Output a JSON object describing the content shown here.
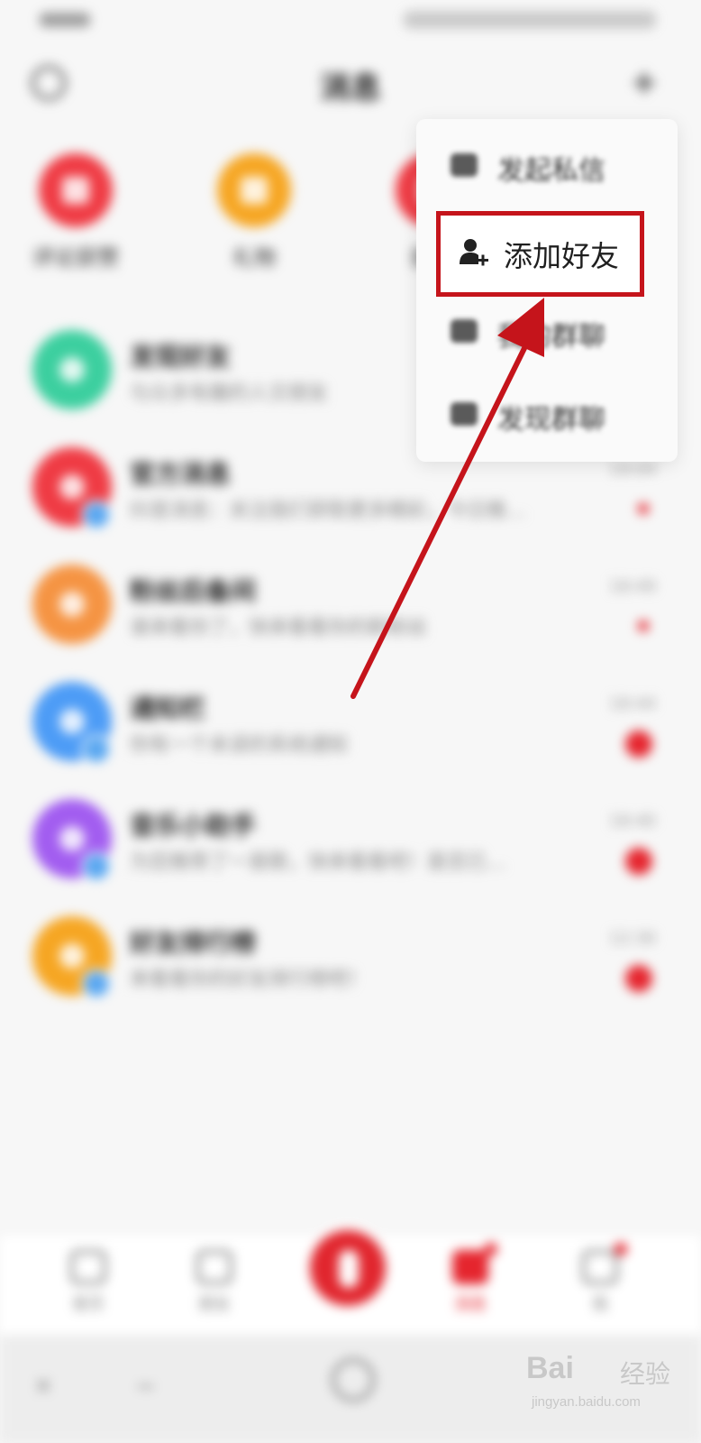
{
  "top_nav": {
    "title": "消息"
  },
  "shortcuts": [
    {
      "label": "评论获赞",
      "color": "#ef3b44"
    },
    {
      "label": "礼物",
      "color": "#f6a623"
    },
    {
      "label": "提醒",
      "color": "#ef3b44"
    }
  ],
  "menu": {
    "items": [
      {
        "label": "发起私信",
        "icon": "chat-icon"
      },
      {
        "label": "添加好友",
        "icon": "add-user-icon"
      },
      {
        "label": "我的群聊",
        "icon": "group-icon"
      },
      {
        "label": "发现群聊",
        "icon": "discover-group-icon"
      }
    ]
  },
  "chats": [
    {
      "name": "发现好友",
      "preview": "与众多有趣的人交朋友",
      "time": "",
      "color": "#3ccf9f",
      "badge": "none",
      "corner": false
    },
    {
      "name": "官方消息",
      "preview": "抖音消息：关注我们获取更多精彩，今日推…",
      "time": "19:04",
      "color": "#ef3b44",
      "badge": "dot",
      "corner": true
    },
    {
      "name": "粉丝后备间",
      "preview": "谁来看你了，快来看看你的新粉丝",
      "time": "18:49",
      "color": "#f59443",
      "badge": "dot",
      "corner": false
    },
    {
      "name": "通知栏",
      "preview": "你有一个未读的系统通知",
      "time": "18:44",
      "color": "#4d9cf6",
      "badge": "count",
      "corner": true
    },
    {
      "name": "音乐小助手",
      "preview": "为您推荐了一首歌，快来看看吧！是否已…",
      "time": "18:40",
      "color": "#a25df0",
      "badge": "count",
      "corner": true
    },
    {
      "name": "好友排行榜",
      "preview": "来看看你的好友排行榜吧！",
      "time": "12:30",
      "color": "#f6a623",
      "badge": "count",
      "corner": true
    }
  ],
  "tab_bar": {
    "tabs": [
      {
        "label": "首页",
        "active": false,
        "badge": false
      },
      {
        "label": "朋友",
        "active": false,
        "badge": false
      },
      {
        "label": "消息",
        "active": true,
        "badge": true
      },
      {
        "label": "我",
        "active": false,
        "badge": true
      }
    ]
  },
  "watermark": {
    "brand": "Bai",
    "brand2": "经验",
    "url": "jingyan.baidu.com"
  }
}
